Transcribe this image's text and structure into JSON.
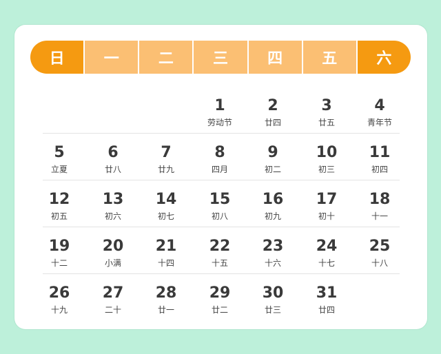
{
  "weekdays": [
    "日",
    "一",
    "二",
    "三",
    "四",
    "五",
    "六"
  ],
  "colors": {
    "background": "#bdf0da",
    "weekend_header": "#f59a11",
    "weekday_header": "#fbbf73",
    "card": "#ffffff"
  },
  "weeks": [
    [
      null,
      null,
      null,
      {
        "day": "1",
        "sub": "劳动节"
      },
      {
        "day": "2",
        "sub": "廿四"
      },
      {
        "day": "3",
        "sub": "廿五"
      },
      {
        "day": "4",
        "sub": "青年节"
      }
    ],
    [
      {
        "day": "5",
        "sub": "立夏"
      },
      {
        "day": "6",
        "sub": "廿八"
      },
      {
        "day": "7",
        "sub": "廿九"
      },
      {
        "day": "8",
        "sub": "四月"
      },
      {
        "day": "9",
        "sub": "初二"
      },
      {
        "day": "10",
        "sub": "初三"
      },
      {
        "day": "11",
        "sub": "初四"
      }
    ],
    [
      {
        "day": "12",
        "sub": "初五"
      },
      {
        "day": "13",
        "sub": "初六"
      },
      {
        "day": "14",
        "sub": "初七"
      },
      {
        "day": "15",
        "sub": "初八"
      },
      {
        "day": "16",
        "sub": "初九"
      },
      {
        "day": "17",
        "sub": "初十"
      },
      {
        "day": "18",
        "sub": "十一"
      }
    ],
    [
      {
        "day": "19",
        "sub": "十二"
      },
      {
        "day": "20",
        "sub": "小满"
      },
      {
        "day": "21",
        "sub": "十四"
      },
      {
        "day": "22",
        "sub": "十五"
      },
      {
        "day": "23",
        "sub": "十六"
      },
      {
        "day": "24",
        "sub": "十七"
      },
      {
        "day": "25",
        "sub": "十八"
      }
    ],
    [
      {
        "day": "26",
        "sub": "十九"
      },
      {
        "day": "27",
        "sub": "二十"
      },
      {
        "day": "28",
        "sub": "廿一"
      },
      {
        "day": "29",
        "sub": "廿二"
      },
      {
        "day": "30",
        "sub": "廿三"
      },
      {
        "day": "31",
        "sub": "廿四"
      },
      null
    ]
  ]
}
